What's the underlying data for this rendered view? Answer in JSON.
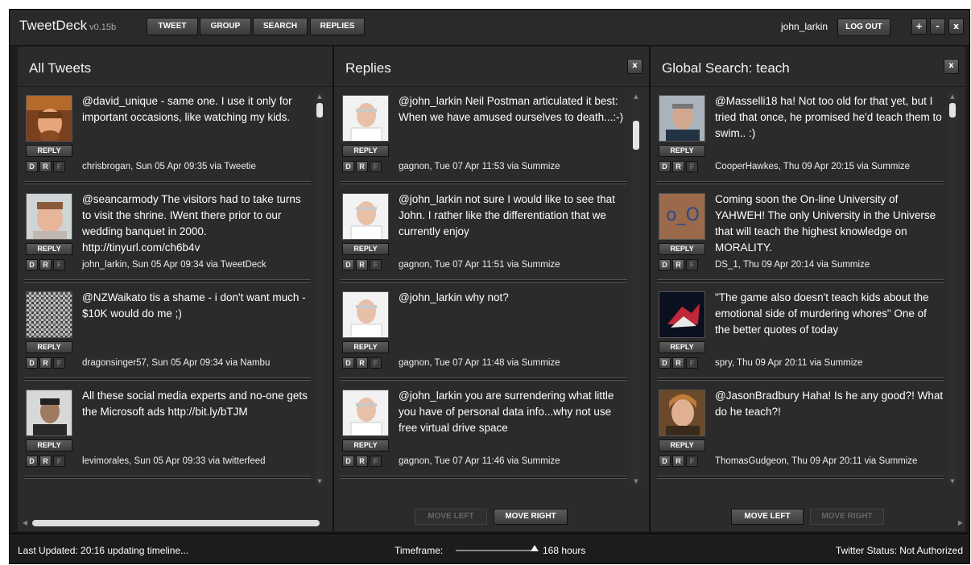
{
  "app": {
    "name": "TweetDeck",
    "version": "v0.15b"
  },
  "toolbar": {
    "tweet": "TWEET",
    "group": "GROUP",
    "search": "SEARCH",
    "replies": "REPLIES"
  },
  "user": {
    "name": "john_larkin",
    "logout": "LOG OUT"
  },
  "window_buttons": {
    "add": "+",
    "minimize": "-",
    "close": "x"
  },
  "tweet_controls": {
    "reply": "REPLY",
    "d": "D",
    "r": "R",
    "f": "F"
  },
  "columns": [
    {
      "title": "All Tweets",
      "tweets": [
        {
          "text": "@david_unique - same one. I use it only for important occasions, like watching my kids.",
          "meta": "chrisbrogan, Sun 05 Apr 09:35 via Tweetie"
        },
        {
          "text": "@seancarmody The visitors had to take turns to visit the shrine. IWent there prior to our wedding banquet in 2000. http://tinyurl.com/ch6b4v",
          "meta": "john_larkin, Sun 05 Apr 09:34 via TweetDeck"
        },
        {
          "text": "@NZWaikato tis a shame - i don't want much - $10K would do me ;)",
          "meta": "dragonsinger57, Sun 05 Apr 09:34 via Nambu"
        },
        {
          "text": "All these social media experts and no-one gets the Microsoft ads http://bit.ly/bTJM",
          "meta": "levimorales, Sun 05 Apr 09:33 via twitterfeed"
        }
      ]
    },
    {
      "title": "Replies",
      "close": "x",
      "tweets": [
        {
          "text": "@john_larkin Neil Postman articulated it best: When we have amused ourselves to death...:-)",
          "meta": "gagnon, Tue 07 Apr 11:53 via Summize"
        },
        {
          "text": "@john_larkin not sure I would like to see that John. I rather like the differentiation that we currently enjoy",
          "meta": "gagnon, Tue 07 Apr 11:51 via Summize"
        },
        {
          "text": "@john_larkin why not?",
          "meta": "gagnon, Tue 07 Apr 11:48 via Summize"
        },
        {
          "text": "@john_larkin you are surrendering what little you have of personal data info...why not use free virtual drive space",
          "meta": "gagnon, Tue 07 Apr 11:46 via Summize"
        }
      ],
      "move_left": "MOVE LEFT",
      "move_right": "MOVE RIGHT"
    },
    {
      "title": "Global Search: teach",
      "close": "x",
      "tweets": [
        {
          "text": "@Masselli18 ha! Not too old for that yet, but I tried that once, he promised he'd teach them to swim.. :)",
          "meta": "CooperHawkes, Thu 09 Apr 20:15 via Summize"
        },
        {
          "text": "Coming soon the On-line University of YAHWEH! The only University in the Universe that will teach the highest knowledge on MORALITY.",
          "meta": "DS_1, Thu 09 Apr 20:14 via Summize",
          "avatar_text": "o_O"
        },
        {
          "text": "\"The game also doesn't teach kids about the emotional side of murdering whores\" One of the better quotes of today",
          "meta": "spry, Thu 09 Apr 20:11 via Summize"
        },
        {
          "text": "@JasonBradbury Haha! Is he any good?! What do he teach?!",
          "meta": "ThomasGudgeon, Thu 09 Apr 20:11 via Summize"
        }
      ],
      "move_left": "MOVE LEFT",
      "move_right": "MOVE RIGHT"
    }
  ],
  "status": {
    "last_updated": "Last Updated: 20:16 updating timeline...",
    "timeframe_label": "Timeframe:",
    "timeframe_value": "168 hours",
    "twitter_status": "Twitter Status: Not Authorized"
  },
  "colors": {
    "background": "#1d1d1d",
    "panel": "#2b2b2b",
    "text": "#ffffff",
    "button": "#4a4a4a"
  }
}
